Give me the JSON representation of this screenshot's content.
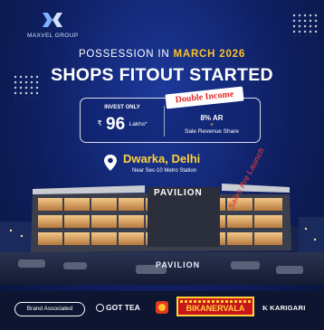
{
  "logo": {
    "brand": "MAXVEL GROUP",
    "icon": "mv-logo-icon"
  },
  "headline": {
    "pre": "POSSESSION IN ",
    "accent": "MARCH 2026",
    "main": "SHOPS FITOUT STARTED"
  },
  "offer": {
    "invest_label": "INVEST ONLY",
    "currency": "₹",
    "amount": "96",
    "unit": "Lakhs*",
    "badge": "Double Income",
    "ar": "8% AR",
    "plus": "+",
    "share": "Sale Revenue Share"
  },
  "location": {
    "icon": "map-pin-icon",
    "name": "Dwarka, Delhi",
    "near": "Near Sec-10 Metro Station"
  },
  "building": {
    "sign_top": "PAVILION",
    "sign_bottom": "PAVILION",
    "watermark": "Sales Pre Launch"
  },
  "footer": {
    "brand_associated": "Brand Associated",
    "brands": {
      "got_tea": "GOT TEA",
      "bikanervala": "BIKANERVALA",
      "karigari": "KARIGARI",
      "karigari_mark": "K"
    }
  },
  "colors": {
    "accent": "#ffc229",
    "badge_text": "#e32727",
    "background": "#10226a",
    "bikanervala": "#c8141b"
  }
}
